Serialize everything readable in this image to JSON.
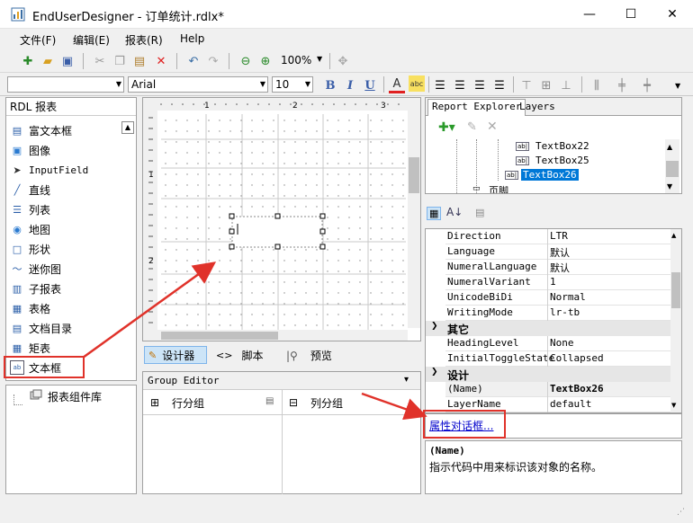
{
  "window": {
    "title": "EndUserDesigner - 订单统计.rdlx*",
    "minimize": "—",
    "maximize": "☐",
    "close": "✕"
  },
  "menu": [
    "文件(F)",
    "编辑(E)",
    "报表(R)",
    "Help"
  ],
  "toolbar": {
    "zoom": "100%"
  },
  "format_toolbar": {
    "font": "Arial",
    "size": "10",
    "bold": "B",
    "italic": "I",
    "underline": "U",
    "font_color": "A",
    "highlight": "abc"
  },
  "left_panel": {
    "title": "RDL 报表",
    "tools": [
      {
        "label": "富文本框",
        "icon": "rich-text-icon"
      },
      {
        "label": "图像",
        "icon": "image-icon"
      },
      {
        "label": "InputField",
        "icon": "input-field-icon"
      },
      {
        "label": "直线",
        "icon": "line-icon"
      },
      {
        "label": "列表",
        "icon": "list-icon"
      },
      {
        "label": "地图",
        "icon": "map-icon"
      },
      {
        "label": "形状",
        "icon": "shape-icon"
      },
      {
        "label": "迷你图",
        "icon": "sparkline-icon"
      },
      {
        "label": "子报表",
        "icon": "subreport-icon"
      },
      {
        "label": "表格",
        "icon": "table-icon"
      },
      {
        "label": "文档目录",
        "icon": "toc-icon"
      },
      {
        "label": "矩表",
        "icon": "matrix-icon"
      },
      {
        "label": "文本框",
        "icon": "textbox-icon"
      }
    ],
    "library": "报表组件库"
  },
  "ruler": {
    "marks": [
      "1",
      "2",
      "3"
    ],
    "vmarks": [
      "1",
      "2",
      "3"
    ]
  },
  "tabs": {
    "designer": "设计器",
    "script": "脚本",
    "preview": "预览"
  },
  "group_editor": {
    "title": "Group Editor",
    "row_group": "行分组",
    "col_group": "列分组"
  },
  "explorer": {
    "tab_report": "Report Explorer",
    "tab_layers": "Layers",
    "items": [
      "TextBox22",
      "TextBox25",
      "TextBox26",
      "页脚"
    ]
  },
  "properties": {
    "rows": [
      {
        "name": "Direction",
        "value": "LTR"
      },
      {
        "name": "Language",
        "value": "默认"
      },
      {
        "name": "NumeralLanguage",
        "value": "默认"
      },
      {
        "name": "NumeralVariant",
        "value": "1"
      },
      {
        "name": "UnicodeBiDi",
        "value": "Normal"
      },
      {
        "name": "WritingMode",
        "value": "lr-tb"
      }
    ],
    "cat_other": "其它",
    "rows2": [
      {
        "name": "HeadingLevel",
        "value": "None"
      },
      {
        "name": "InitialToggleState",
        "value": "Collapsed"
      }
    ],
    "cat_design": "设计",
    "rows3": [
      {
        "name": "(Name)",
        "value": "TextBox26"
      },
      {
        "name": "LayerName",
        "value": "default"
      }
    ],
    "link": "属性对话框...",
    "desc_title": "(Name)",
    "desc_text": "指示代码中用来标识该对象的名称。"
  }
}
